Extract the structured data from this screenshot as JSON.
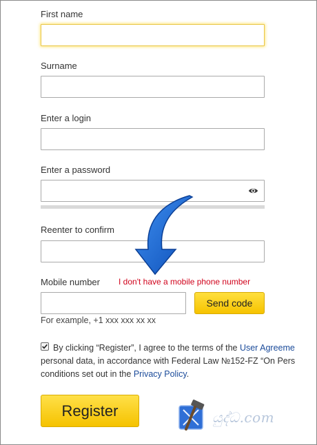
{
  "form": {
    "first_name_label": "First name",
    "first_name_value": "",
    "surname_label": "Surname",
    "surname_value": "",
    "login_label": "Enter a login",
    "login_value": "",
    "password_label": "Enter a password",
    "password_value": "",
    "confirm_label": "Reenter to confirm",
    "confirm_value": "",
    "mobile_label": "Mobile number",
    "no_mobile_link": "I don't have a mobile phone number",
    "mobile_value": "",
    "send_code_button": "Send code",
    "example_text": "For example, +1 xxx xxx xx xx"
  },
  "agreement": {
    "checked": true,
    "line1_prefix": "By clicking “Register”, I agree to the terms of the ",
    "user_agreement_link": "User Agreeme",
    "line2": "personal data, in accordance with Federal Law №152-FZ “On Pers",
    "line3_prefix": "conditions set out in the ",
    "privacy_link": "Privacy Policy",
    "line3_suffix": "."
  },
  "register_button": "Register",
  "watermark": {
    "text": "යුද්ධ.com"
  },
  "colors": {
    "accent_yellow": "#ffd000",
    "link_blue": "#1b4b9a",
    "error_red": "#d0021b",
    "arrow_blue": "#1a66d6"
  },
  "icons": [
    "eye-icon",
    "checkbox-checked",
    "arrow-annotation",
    "xcode-hammer-logo"
  ]
}
